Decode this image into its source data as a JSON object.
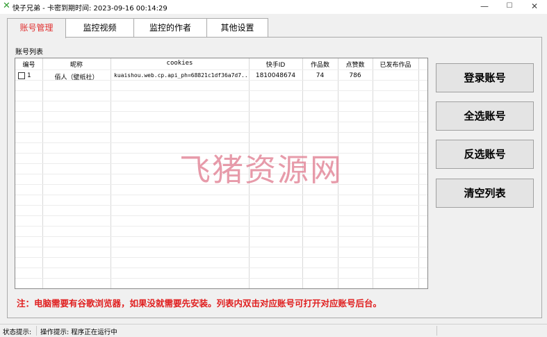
{
  "window": {
    "title": "快子兄弟  -  卡密到期时间: 2023-09-16 00:14:29",
    "minimize": "—",
    "maximize": "☐",
    "close": "✕"
  },
  "tabs": [
    {
      "label": "账号管理",
      "active": true
    },
    {
      "label": "监控视频",
      "active": false
    },
    {
      "label": "监控的作者",
      "active": false
    },
    {
      "label": "其他设置",
      "active": false
    }
  ],
  "account_list": {
    "section_label": "账号列表",
    "columns": [
      "编号",
      "昵称",
      "cookies",
      "快手ID",
      "作品数",
      "点赞数",
      "已发布作品"
    ],
    "rows": [
      {
        "no": "1",
        "nickname": "佰人（壁纸社）",
        "cookies": "kuaishou.web.cp.api_ph=68821c1df36a7d7...",
        "kuaishou_id": "1810048674",
        "works": "74",
        "likes": "786",
        "published": ""
      }
    ]
  },
  "buttons": {
    "login": "登录账号",
    "select_all": "全选账号",
    "invert": "反选账号",
    "clear": "清空列表"
  },
  "watermark": "飞猪资源网",
  "note": "注：电脑需要有谷歌浏览器，如果没就需要先安装。列表内双击对应账号可打开对应账号后台。",
  "status": {
    "label": "状态提示:",
    "message": "操作提示: 程序正在运行中"
  },
  "colors": {
    "active_tab": "#e03030",
    "note": "#e02020",
    "watermark": "#e07a8e",
    "app_icon": "#2e9b2e"
  },
  "icons": {
    "app": "x-logo-icon"
  }
}
